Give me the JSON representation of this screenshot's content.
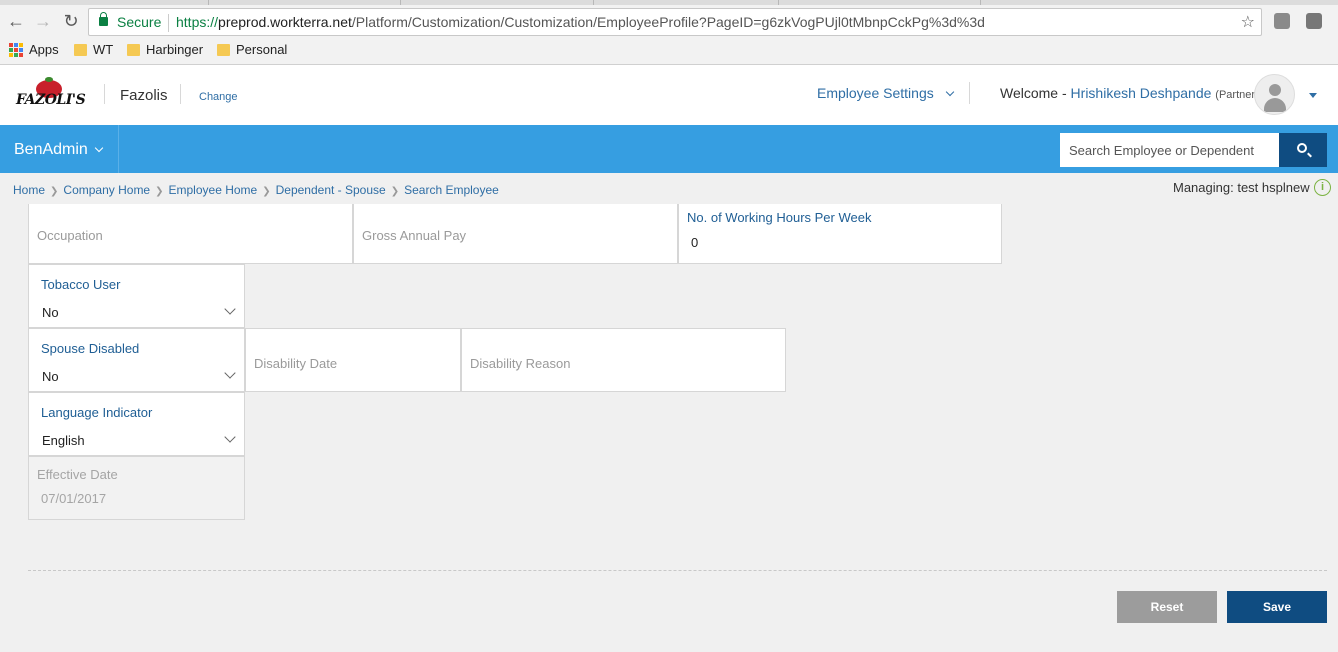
{
  "browser": {
    "secure_label": "Secure",
    "url_proto": "https://",
    "url_host": "preprod.workterra.net",
    "url_path": "/Platform/Customization/Customization/EmployeeProfile?PageID=g6zkVogPUjl0tMbnpCckPg%3d%3d",
    "bookmarks": [
      "Apps",
      "WT",
      "Harbinger",
      "Personal"
    ]
  },
  "header": {
    "logo_text": "FAZOLI'S",
    "company": "Fazolis",
    "change_link": "Change",
    "employee_settings": "Employee Settings",
    "welcome_prefix": "Welcome -",
    "user_name": "Hrishikesh Deshpande",
    "user_role": "(Partner)"
  },
  "bluebar": {
    "module": "BenAdmin",
    "search_placeholder": "Search Employee or Dependent"
  },
  "breadcrumb": [
    "Home",
    "Company Home",
    "Employee Home",
    "Dependent - Spouse",
    "Search Employee"
  ],
  "managing": {
    "label": "Managing:",
    "value": "test hsplnew"
  },
  "form": {
    "occupation_placeholder": "Occupation",
    "gross_annual_pay_placeholder": "Gross Annual Pay",
    "working_hours_label": "No. of Working Hours Per Week",
    "working_hours_value": "0",
    "tobacco_label": "Tobacco User",
    "tobacco_value": "No",
    "spouse_disabled_label": "Spouse Disabled",
    "spouse_disabled_value": "No",
    "disability_date_placeholder": "Disability Date",
    "disability_reason_placeholder": "Disability Reason",
    "language_label": "Language Indicator",
    "language_value": "English",
    "effective_date_label": "Effective Date",
    "effective_date_value": "07/01/2017"
  },
  "actions": {
    "reset": "Reset",
    "save": "Save"
  },
  "colors": {
    "brand_blue": "#369ee1",
    "dark_blue": "#0f4c81",
    "link_blue": "#2f6ea5"
  }
}
